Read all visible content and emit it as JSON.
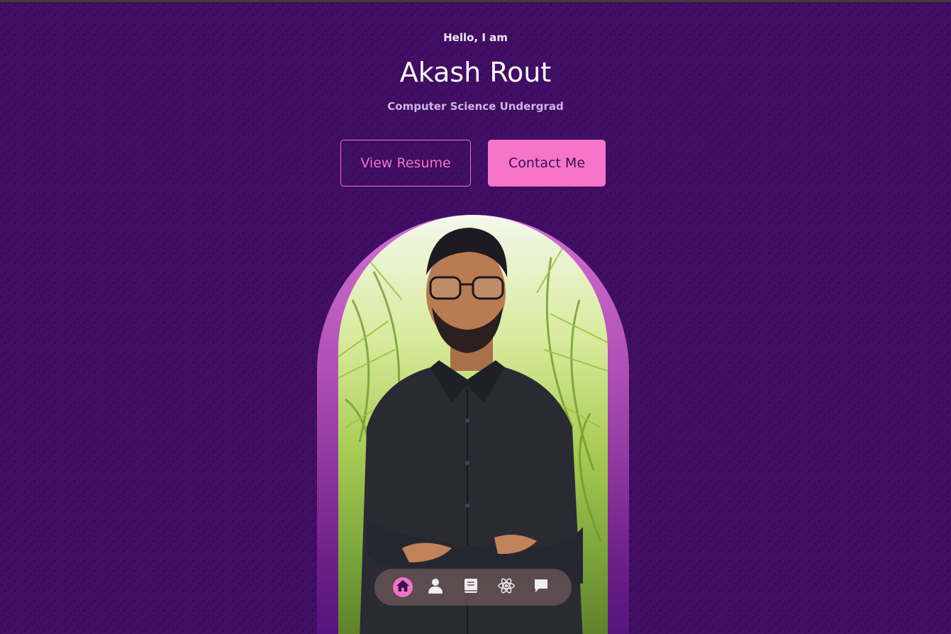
{
  "hero": {
    "greeting": "Hello, I am",
    "name": "Akash Rout",
    "subtitle": "Computer Science Undergrad"
  },
  "buttons": {
    "resume_label": "View Resume",
    "contact_label": "Contact Me"
  },
  "dock": {
    "items": [
      {
        "icon": "home-icon",
        "active": true
      },
      {
        "icon": "user-icon",
        "active": false
      },
      {
        "icon": "book-icon",
        "active": false
      },
      {
        "icon": "react-atom-icon",
        "active": false
      },
      {
        "icon": "message-icon",
        "active": false
      }
    ]
  },
  "colors": {
    "background": "#420e66",
    "accent": "#f675c8",
    "text": "#ffffff"
  }
}
